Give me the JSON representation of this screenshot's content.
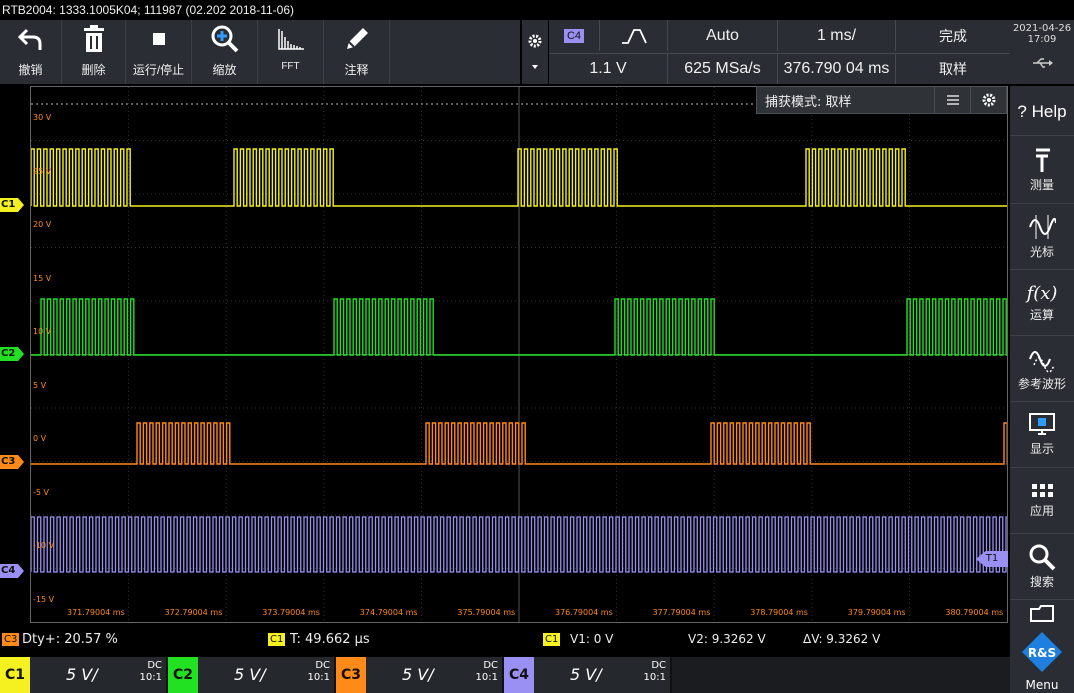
{
  "title": "RTB2004: 1333.1005K04; 111987 (02.202 2018-11-06)",
  "toolbar": [
    {
      "name": "undo",
      "label": "撤销",
      "icon": "undo-icon"
    },
    {
      "name": "delete",
      "label": "删除",
      "icon": "trash-icon"
    },
    {
      "name": "run-stop",
      "label": "运行/停止",
      "icon": "stop-icon"
    },
    {
      "name": "zoom",
      "label": "缩放",
      "icon": "zoom-icon"
    },
    {
      "name": "fft",
      "label": "FFT",
      "icon": "fft-icon"
    },
    {
      "name": "annotate",
      "label": "注释",
      "icon": "pen-icon"
    }
  ],
  "acq": {
    "trig_source": "C4",
    "trig_mode": "Auto",
    "time_scale": "1 ms/",
    "state": "完成",
    "trig_level": "1.1 V",
    "sample_rate": "625 MSa/s",
    "position": "376.790 04 ms",
    "acq_mode": "取样"
  },
  "datetime": {
    "date": "2021-04-26",
    "time": "17:09"
  },
  "side": [
    {
      "label": "",
      "name": "help",
      "text": "? Help"
    },
    {
      "label": "测量",
      "name": "measure",
      "icon": "measure-icon"
    },
    {
      "label": "光标",
      "name": "cursor",
      "icon": "cursor-icon"
    },
    {
      "label": "运算",
      "name": "math",
      "icon": "fx-icon"
    },
    {
      "label": "参考波形",
      "name": "reference",
      "icon": "reference-icon"
    },
    {
      "label": "显示",
      "name": "display",
      "icon": "display-icon"
    },
    {
      "label": "应用",
      "name": "apps",
      "icon": "apps-icon"
    },
    {
      "label": "搜索",
      "name": "search",
      "icon": "search-icon"
    },
    {
      "label": "",
      "name": "file",
      "icon": "folder-icon"
    }
  ],
  "popup": {
    "text": "捕获模式: 取样"
  },
  "y_labels": [
    "30 V",
    "25 V",
    "20 V",
    "15 V",
    "10 V",
    "5 V",
    "0 V",
    "-5 V",
    "-10 V",
    "-15 V"
  ],
  "x_labels": [
    "371.79004 ms",
    "372.79004 ms",
    "373.79004 ms",
    "374.79004 ms",
    "375.79004 ms",
    "376.79004 ms",
    "377.79004 ms",
    "378.79004 ms",
    "379.79004 ms",
    "380.79004 ms"
  ],
  "channels": [
    {
      "id": "C1",
      "color": "#f5f020",
      "scale": "5 V/",
      "coupling": "DC",
      "probe": "10:1"
    },
    {
      "id": "C2",
      "color": "#22e022",
      "scale": "5 V/",
      "coupling": "DC",
      "probe": "10:1"
    },
    {
      "id": "C3",
      "color": "#ff8a1a",
      "scale": "5 V/",
      "coupling": "DC",
      "probe": "10:1"
    },
    {
      "id": "C4",
      "color": "#9a8ff2",
      "scale": "5 V/",
      "coupling": "DC",
      "probe": "10:1"
    }
  ],
  "status": {
    "dty_ch": "C3",
    "dty": "Dty+: 20.57 %",
    "t_ch": "C1",
    "t": "T: 49.662 µs",
    "cur_ch": "C1",
    "v1": "V1: 0 V",
    "v2": "V2: 9.3262 V",
    "dv": "ΔV: 9.3262 V"
  },
  "trigger_label": "T1",
  "menu_label": "Menu"
}
